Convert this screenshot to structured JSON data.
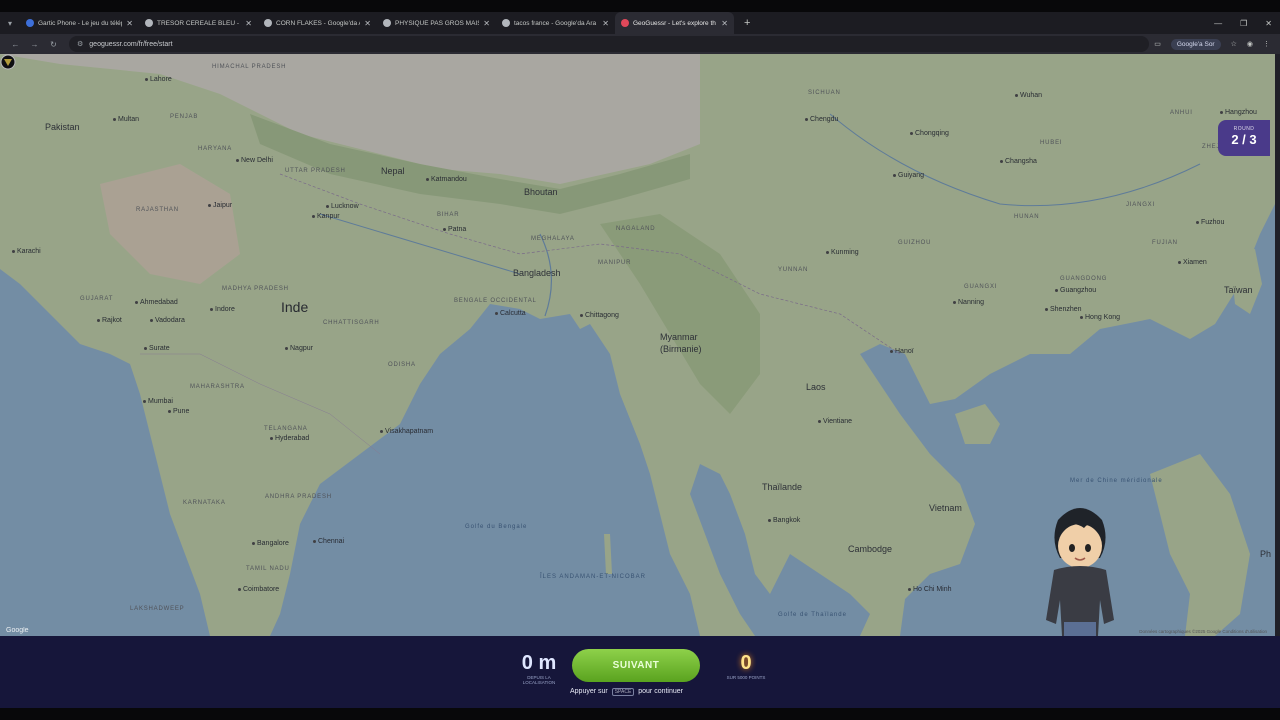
{
  "browser": {
    "tabs": [
      {
        "title": "Gartic Phone - Le jeu du télép",
        "icon": "gartic-icon"
      },
      {
        "title": "TRESOR CEREALE BLEU - Goog",
        "icon": "google-icon"
      },
      {
        "title": "CORN FLAKES - Google'da Ara",
        "icon": "google-icon"
      },
      {
        "title": "PHYSIQUE PAS GROS MAIS FI",
        "icon": "google-icon"
      },
      {
        "title": "tacos france - Google'da Ara",
        "icon": "google-icon"
      },
      {
        "title": "GeoGuessr - Let's explore th",
        "icon": "geoguessr-icon",
        "active": true
      }
    ],
    "url": "geoguessr.com/fr/free/start",
    "profile_pill": "Google'a Sor"
  },
  "game": {
    "round_label": "ROUND",
    "round_value": "2 / 3",
    "distance_value": "0 m",
    "distance_sub": "DEPUIS LA LOCALISATION",
    "next_button": "SUIVANT",
    "hint_before": "Appuyer sur",
    "hint_key": "SPACE",
    "hint_after": "pour continuer",
    "score_value": "0",
    "score_sub": "SUR 5000 POINTS"
  },
  "map": {
    "countries": [
      "Pakistan",
      "Nepal",
      "Bhoutan",
      "Bangladesh",
      "Inde",
      "Myanmar",
      "(Birmanie)",
      "Laos",
      "Thaïlande",
      "Cambodge",
      "Vietnam",
      "Taïwan",
      "Ph"
    ],
    "cities": [
      "Lahore",
      "New Delhi",
      "Jaipur",
      "Lucknow",
      "Kanpur",
      "Katmandou",
      "Patna",
      "Ahmedabad",
      "Vadodara",
      "Indore",
      "Surate",
      "Nagpur",
      "Rajkot",
      "Mumbai",
      "Pune",
      "Hyderabad",
      "Visakhapatnam",
      "Bangalore",
      "Chennai",
      "Coimbatore",
      "Calcutta",
      "Chittagong",
      "Kunming",
      "Chongqing",
      "Chengdu",
      "Wuhan",
      "Changsha",
      "Guiyang",
      "Nanning",
      "Guangzhou",
      "Shenzhen",
      "Hong Kong",
      "Hanoï",
      "Bangkok",
      "Ho Chi Minh",
      "Vientiane",
      "Hangzhou",
      "Xiamen",
      "Fuzhou",
      "Multan",
      "Karachi"
    ],
    "regions": [
      "HIMACHAL PRADESH",
      "PENJAB",
      "HARYANA",
      "RAJASTHAN",
      "UTTAR PRADESH",
      "BIHAR",
      "MEGHALAYA",
      "NAGALAND",
      "MANIPUR",
      "GUJARAT",
      "MADHYA PRADESH",
      "CHHATTISGARH",
      "MAHARASHTRA",
      "TELANGANA",
      "KARNATAKA",
      "ANDHRA PRADESH",
      "TAMIL NADU",
      "ODISHA",
      "BENGALE OCCIDENTAL",
      "YUNNAN",
      "SICHUAN",
      "GUIZHOU",
      "GUANGXI",
      "GUANGDONG",
      "HUNAN",
      "JIANGXI",
      "FUJIAN",
      "HUBEI",
      "ZHEJIANG",
      "ANHUI"
    ],
    "seas": [
      "ÎLES ANDAMAN-ET-NICOBAR",
      "Golfe du Bengale",
      "Mer de Chine méridionale",
      "Golfe de Thaïlande",
      "LAKSHADWEEP"
    ],
    "attribution": "Google",
    "copyright": "Données cartographiques ©2025 Google  Conditions d'utilisation"
  }
}
